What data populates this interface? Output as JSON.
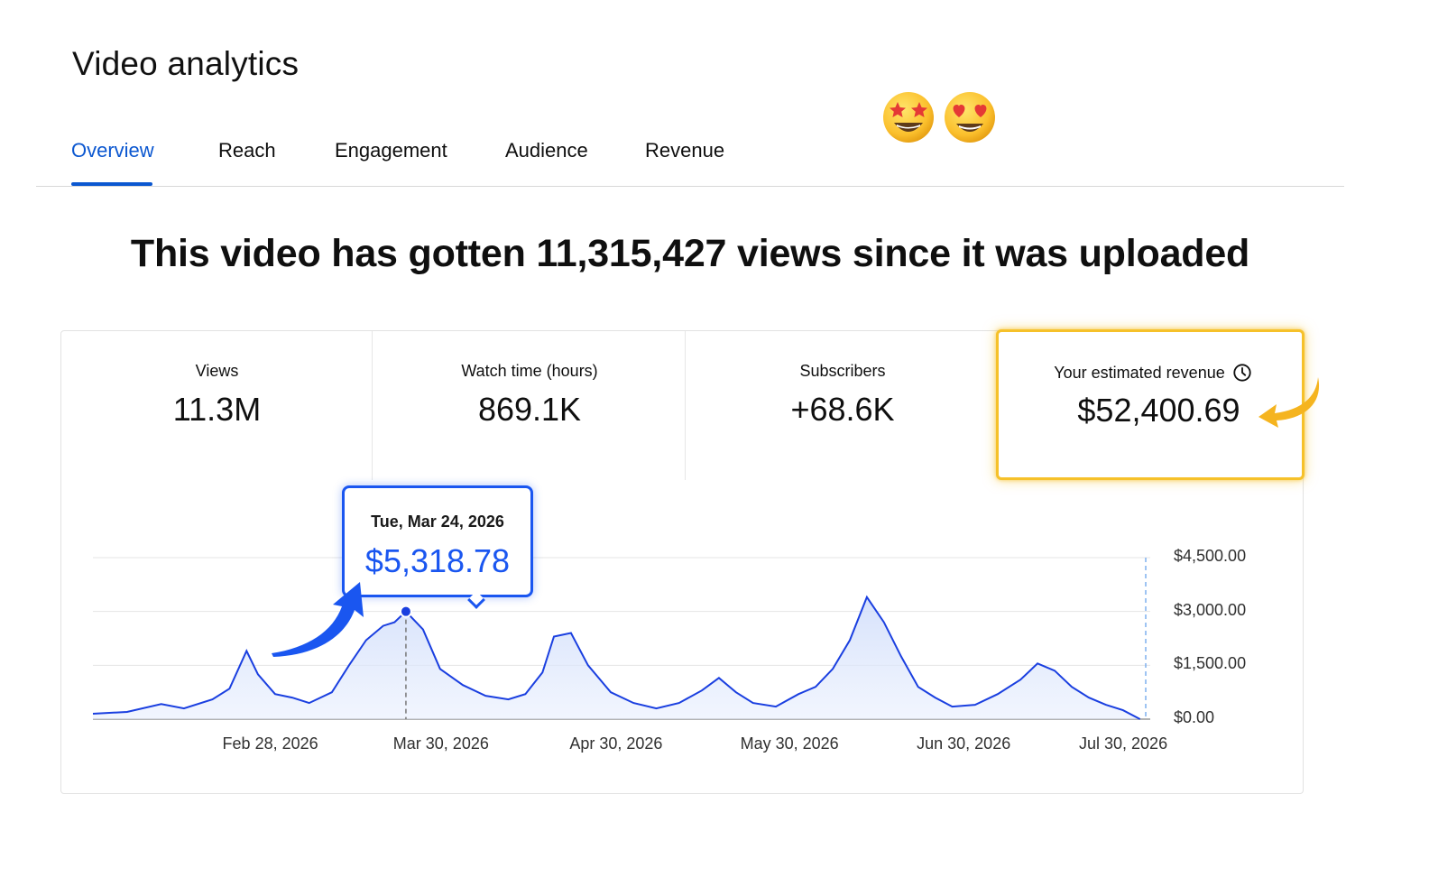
{
  "page": {
    "title": "Video analytics"
  },
  "tabs": [
    {
      "label": "Overview",
      "active": true
    },
    {
      "label": "Reach",
      "active": false
    },
    {
      "label": "Engagement",
      "active": false
    },
    {
      "label": "Audience",
      "active": false
    },
    {
      "label": "Revenue",
      "active": false
    }
  ],
  "headline": "This video has gotten 11,315,427 views since it was uploaded",
  "metrics": [
    {
      "label": "Views",
      "value": "11.3M"
    },
    {
      "label": "Watch time (hours)",
      "value": "869.1K"
    },
    {
      "label": "Subscribers",
      "value": "+68.6K"
    },
    {
      "label": "Your estimated revenue",
      "value": "$52,400.69",
      "icon": "clock-icon"
    }
  ],
  "tooltip": {
    "date": "Tue, Mar 24, 2026",
    "amount": "$5,318.78"
  },
  "emojis": [
    "star-struck-emoji",
    "heart-eyes-emoji"
  ],
  "colors": {
    "accent": "#0b57d0",
    "series": "#1a3fe0",
    "highlight": "#f6c12a",
    "arrow_yellow": "#f5b41f",
    "arrow_blue": "#1a56f0"
  },
  "chart_data": {
    "type": "area",
    "x_tick_labels": [
      "Feb 28, 2026",
      "Mar 30, 2026",
      "Apr 30, 2026",
      "May 30, 2026",
      "Jun 30, 2026",
      "Jul 30, 2026"
    ],
    "y_tick_labels": [
      "$0.00",
      "$1,500.00",
      "$3,000.00",
      "$4,500.00"
    ],
    "y_ticks": [
      0,
      1500,
      3000,
      4500
    ],
    "ylim": [
      0,
      4500
    ],
    "xlim": [
      "2026-01-28",
      "2026-08-01"
    ],
    "grid": true,
    "series": [
      {
        "x": [
          "2026-01-28",
          "2026-02-03",
          "2026-02-09",
          "2026-02-13",
          "2026-02-18",
          "2026-02-21",
          "2026-02-24",
          "2026-02-26",
          "2026-03-01",
          "2026-03-04",
          "2026-03-07",
          "2026-03-11",
          "2026-03-14",
          "2026-03-17",
          "2026-03-20",
          "2026-03-22",
          "2026-03-24",
          "2026-03-27",
          "2026-03-30",
          "2026-04-03",
          "2026-04-07",
          "2026-04-11",
          "2026-04-14",
          "2026-04-17",
          "2026-04-19",
          "2026-04-22",
          "2026-04-25",
          "2026-04-29",
          "2026-05-03",
          "2026-05-07",
          "2026-05-11",
          "2026-05-15",
          "2026-05-18",
          "2026-05-21",
          "2026-05-24",
          "2026-05-28",
          "2026-06-01",
          "2026-06-04",
          "2026-06-07",
          "2026-06-10",
          "2026-06-13",
          "2026-06-16",
          "2026-06-19",
          "2026-06-22",
          "2026-06-25",
          "2026-06-28",
          "2026-07-02",
          "2026-07-06",
          "2026-07-10",
          "2026-07-13",
          "2026-07-16",
          "2026-07-19",
          "2026-07-22",
          "2026-07-25",
          "2026-07-28",
          "2026-07-31"
        ],
        "values": [
          150,
          200,
          420,
          300,
          550,
          850,
          1900,
          1250,
          700,
          600,
          450,
          750,
          1500,
          2200,
          2600,
          2700,
          3000,
          2500,
          1400,
          950,
          650,
          550,
          700,
          1300,
          2300,
          2400,
          1500,
          750,
          450,
          300,
          450,
          800,
          1150,
          750,
          450,
          350,
          700,
          900,
          1400,
          2200,
          3400,
          2700,
          1750,
          900,
          600,
          350,
          400,
          700,
          1100,
          1550,
          1350,
          900,
          600,
          400,
          250,
          0
        ]
      }
    ],
    "highlight_point": {
      "x": "2026-03-24",
      "value": 3000
    }
  }
}
